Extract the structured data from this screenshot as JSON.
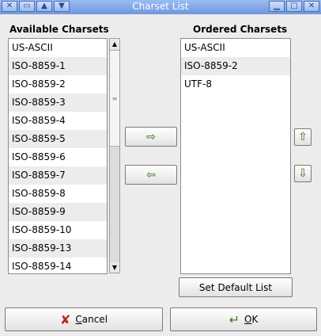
{
  "window": {
    "title": "Charset List"
  },
  "labels": {
    "available": "Available Charsets",
    "ordered": "Ordered Charsets"
  },
  "available": [
    "US-ASCII",
    "ISO-8859-1",
    "ISO-8859-2",
    "ISO-8859-3",
    "ISO-8859-4",
    "ISO-8859-5",
    "ISO-8859-6",
    "ISO-8859-7",
    "ISO-8859-8",
    "ISO-8859-9",
    "ISO-8859-10",
    "ISO-8859-13",
    "ISO-8859-14"
  ],
  "ordered": [
    "US-ASCII",
    "ISO-8859-2",
    "UTF-8"
  ],
  "buttons": {
    "set_default": "Set Default List",
    "cancel_u": "C",
    "cancel_rest": "ancel",
    "ok_u": "O",
    "ok_rest": "K"
  }
}
